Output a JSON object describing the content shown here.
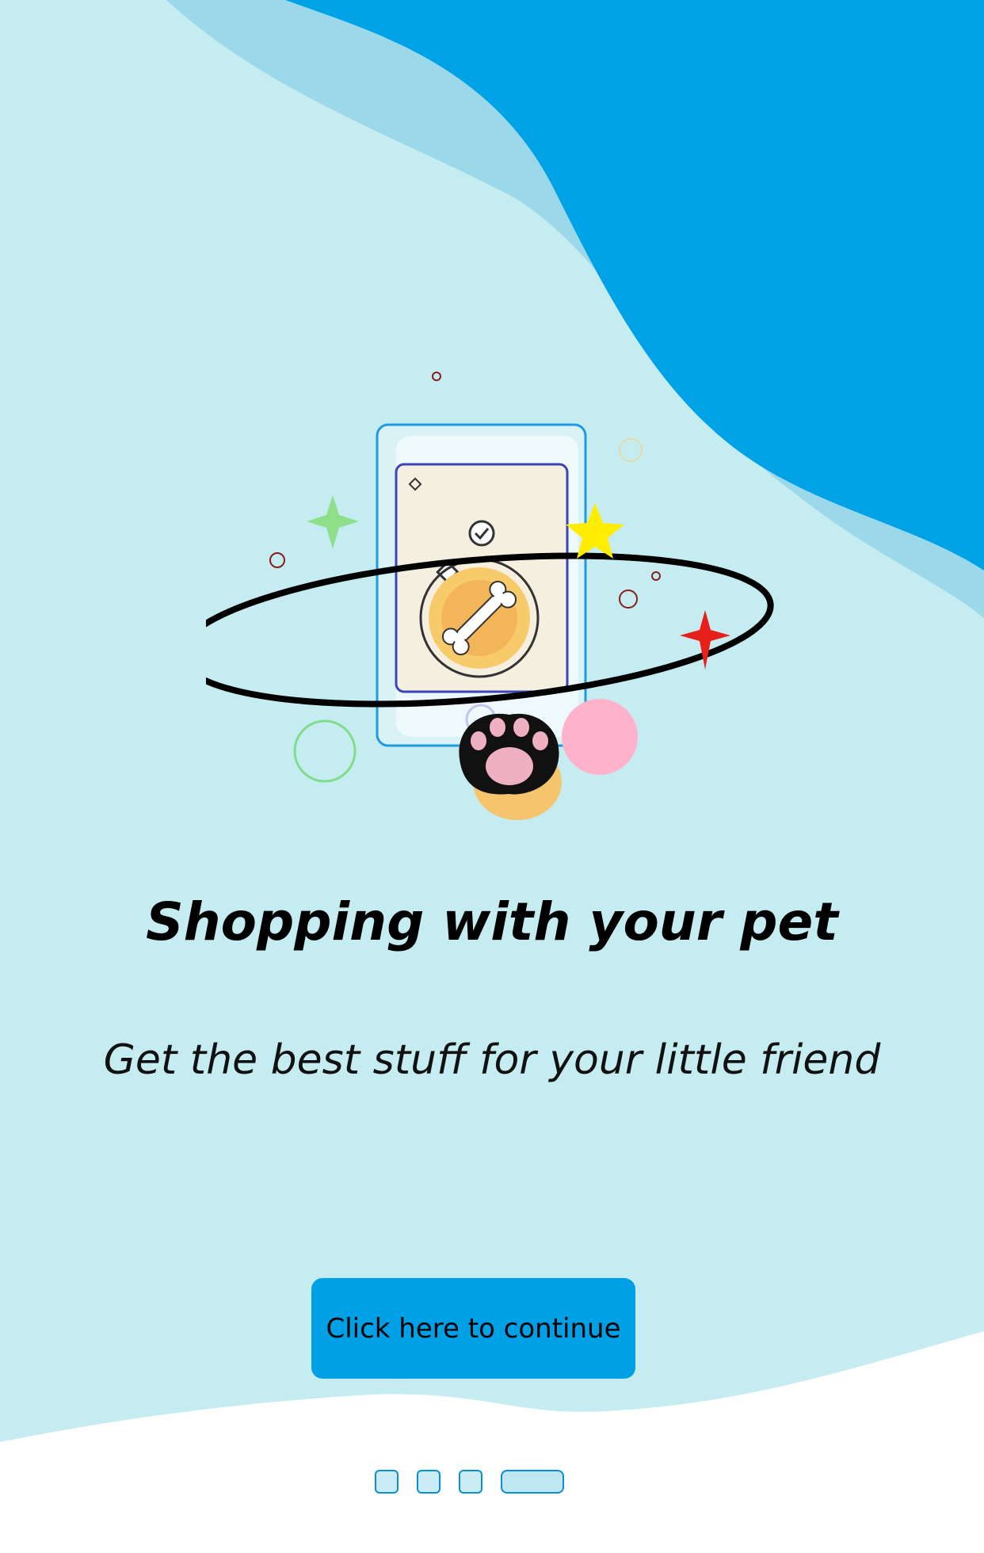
{
  "onboarding": {
    "headline": "Shopping with your pet",
    "subtitle": "Get the best stuff for your little friend",
    "cta_label": "Click here to continue",
    "current_page": 4,
    "total_pages": 4
  },
  "illustration": {
    "icons": [
      "phone-icon",
      "bone-coin-icon",
      "check-icon",
      "paw-icon",
      "star-icon",
      "sparkle-icon"
    ]
  },
  "colors": {
    "page_background": "#c5ecf0",
    "wave_dark": "#00a2e6",
    "wave_light": "#9bd9ea",
    "bottom_wave": "#ffffff",
    "button": "#00a0e6",
    "dot_border": "#0a8fd3"
  }
}
